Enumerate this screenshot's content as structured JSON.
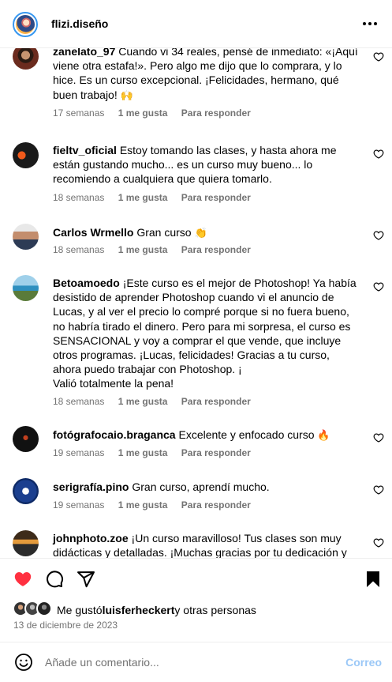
{
  "header": {
    "username": "flizi.diseño",
    "more_icon": "more-horizontal-icon"
  },
  "comments": [
    {
      "user": "zanelato_97",
      "text": "Cuando vi 34 reales, pensé de inmediato: «¡Aquí viene otra estafa!». Pero algo me dijo que lo comprara, y lo hice. Es un curso excepcional. ¡Felicidades, hermano, qué buen trabajo!",
      "emoji": "🙌",
      "time": "17 semanas",
      "likes": "1 me gusta",
      "reply": "Para responder"
    },
    {
      "user": "fieltv_oficial",
      "text": "Estoy tomando las clases, y hasta ahora me están gustando mucho... es un curso muy bueno... lo recomiendo a cualquiera que quiera tomarlo.",
      "emoji": "",
      "time": "18 semanas",
      "likes": "1 me gusta",
      "reply": "Para responder"
    },
    {
      "user": "Carlos Wrmello",
      "text": "Gran curso",
      "emoji": "👏",
      "time": "18 semanas",
      "likes": "1 me gusta",
      "reply": "Para responder"
    },
    {
      "user": "Betoamoedo",
      "text": "¡Este curso es el mejor de Photoshop! Ya había desistido de aprender Photoshop cuando vi el anuncio de Lucas, y al ver el precio lo compré porque si no fuera bueno, no habría tirado el dinero. Pero para mi sorpresa, el curso es SENSACIONAL y voy a comprar el que vende, que incluye otros programas. ¡Lucas, felicidades! Gracias a tu curso, ahora puedo trabajar con Photoshop. ¡",
      "text2": "Valió totalmente la pena!",
      "emoji": "",
      "time": "18 semanas",
      "likes": "1 me gusta",
      "reply": "Para responder"
    },
    {
      "user": "fotógrafocaio.braganca",
      "text": "Excelente y enfocado curso",
      "emoji": "🔥",
      "time": "19 semanas",
      "likes": "1 me gusta",
      "reply": "Para responder"
    },
    {
      "user": "serigrafía.pino",
      "text": "Gran curso, aprendí mucho.",
      "emoji": "",
      "time": "19 semanas",
      "likes": "1 me gusta",
      "reply": "Para responder"
    },
    {
      "user": "johnphoto.zoe",
      "text": "¡Un curso maravilloso! Tus clases son muy didácticas y detalladas. ¡Muchas gracias por tu dedicación y",
      "emoji": "",
      "time": "",
      "likes": "",
      "reply": ""
    }
  ],
  "actions": {
    "like_icon": "heart-filled-icon",
    "comment_icon": "comment-icon",
    "share_icon": "share-icon",
    "save_icon": "bookmark-filled-icon",
    "like_color": "#ff3040"
  },
  "likes_summary": {
    "prefix": "Me gustó",
    "user": "luisferheckert",
    "suffix": "y otras personas"
  },
  "post_date": "13 de diciembre de 2023",
  "add_comment": {
    "placeholder": "Añade un comentario...",
    "post_label": "Correo",
    "post_color": "#9bc8f7"
  }
}
